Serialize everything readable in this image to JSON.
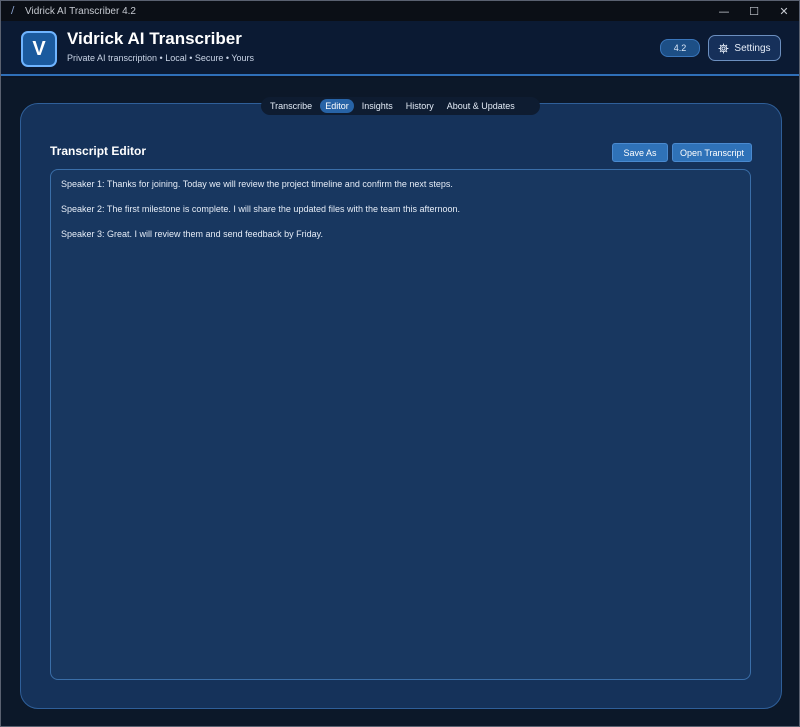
{
  "window": {
    "title": "Vidrick AI Transcriber 4.2",
    "controls": {
      "minimize": "—",
      "maximize": "☐",
      "close": "✕"
    }
  },
  "header": {
    "logo_letter": "V",
    "app_name": "Vidrick AI Transcriber",
    "tagline": "Private AI transcription • Local • Secure • Yours",
    "version": "4.2",
    "settings_label": "Settings"
  },
  "tabs": [
    {
      "label": "Transcribe",
      "active": false
    },
    {
      "label": "Editor",
      "active": true
    },
    {
      "label": "Insights",
      "active": false
    },
    {
      "label": "History",
      "active": false
    },
    {
      "label": "About & Updates",
      "active": false
    }
  ],
  "editor": {
    "title": "Transcript Editor",
    "save_as_label": "Save As",
    "open_label": "Open Transcript",
    "lines": [
      "Speaker 1: Thanks for joining. Today we will review the project timeline and confirm the next steps.",
      "Speaker 2: The first milestone is complete. I will share the updated files with the team this afternoon.",
      "Speaker 3: Great. I will review them and send feedback by Friday."
    ]
  },
  "colors": {
    "accent": "#2f72b8",
    "active_tab": "#2763a6",
    "panel": "#15325a",
    "header": "#0b1a33"
  }
}
